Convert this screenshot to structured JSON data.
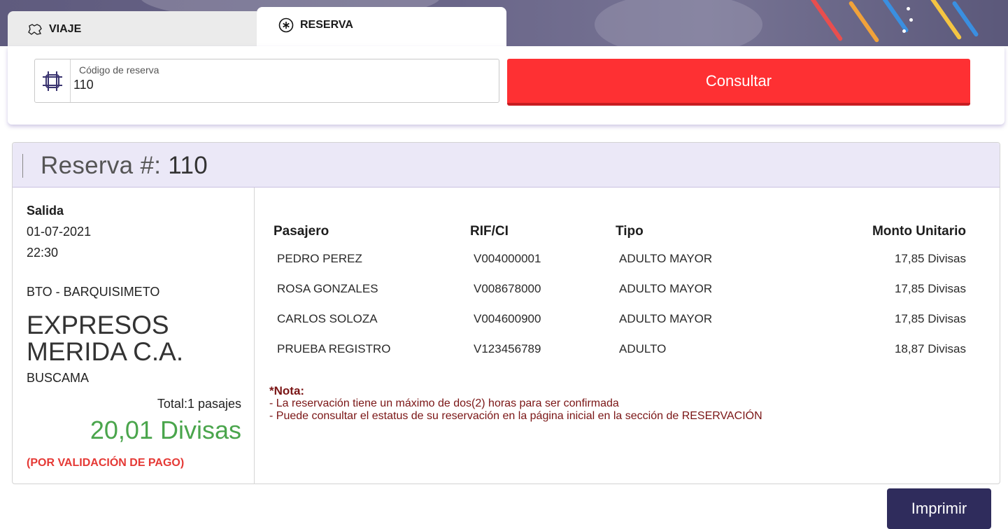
{
  "tabs": {
    "viaje": {
      "label": "VIAJE",
      "icon": "map-icon"
    },
    "reserva": {
      "label": "RESERVA",
      "icon": "asterisk-circle-icon"
    }
  },
  "search": {
    "field_label": "Código de reserva",
    "field_value": "110",
    "field_icon": "hashtag-icon",
    "button_label": "Consultar"
  },
  "reservation": {
    "title_prefix": "Reserva #:",
    "number": "110",
    "summary": {
      "departure_label": "Salida",
      "date": "01-07-2021",
      "time": "22:30",
      "route": "BTO - BARQUISIMETO",
      "company": "EXPRESOS MERIDA C.A.",
      "service": "BUSCAMA",
      "total_label": "Total:1 pasajes",
      "total_amount": "20,01 Divisas",
      "status": "(POR VALIDACIÓN DE PAGO)"
    },
    "table": {
      "headers": [
        "Pasajero",
        "RIF/CI",
        "Tipo",
        "Monto Unitario"
      ],
      "rows": [
        [
          "PEDRO PEREZ",
          "V004000001",
          "ADULTO MAYOR",
          "17,85 Divisas"
        ],
        [
          "ROSA GONZALES",
          "V008678000",
          "ADULTO MAYOR",
          "17,85 Divisas"
        ],
        [
          "CARLOS SOLOZA",
          "V004600900",
          "ADULTO MAYOR",
          "17,85 Divisas"
        ],
        [
          "PRUEBA REGISTRO",
          "V123456789",
          "ADULTO",
          "18,87 Divisas"
        ]
      ]
    },
    "note": {
      "title": "*Nota:",
      "lines": [
        "- La reservación tiene un máximo de dos(2) horas para ser confirmada",
        "- Puede consultar el estatus de su reservación en la página inicial en la sección de RESERVACIÓN"
      ]
    }
  },
  "actions": {
    "print_label": "Imprimir"
  },
  "colors": {
    "accent_red": "#fe3033",
    "tab_underline": "#3b3fe0",
    "header_bg": "#ebe8f7",
    "amount_green": "#4aa54c",
    "status_red": "#e53935",
    "note_red": "#7a1515",
    "print_button": "#2f2c5c"
  }
}
